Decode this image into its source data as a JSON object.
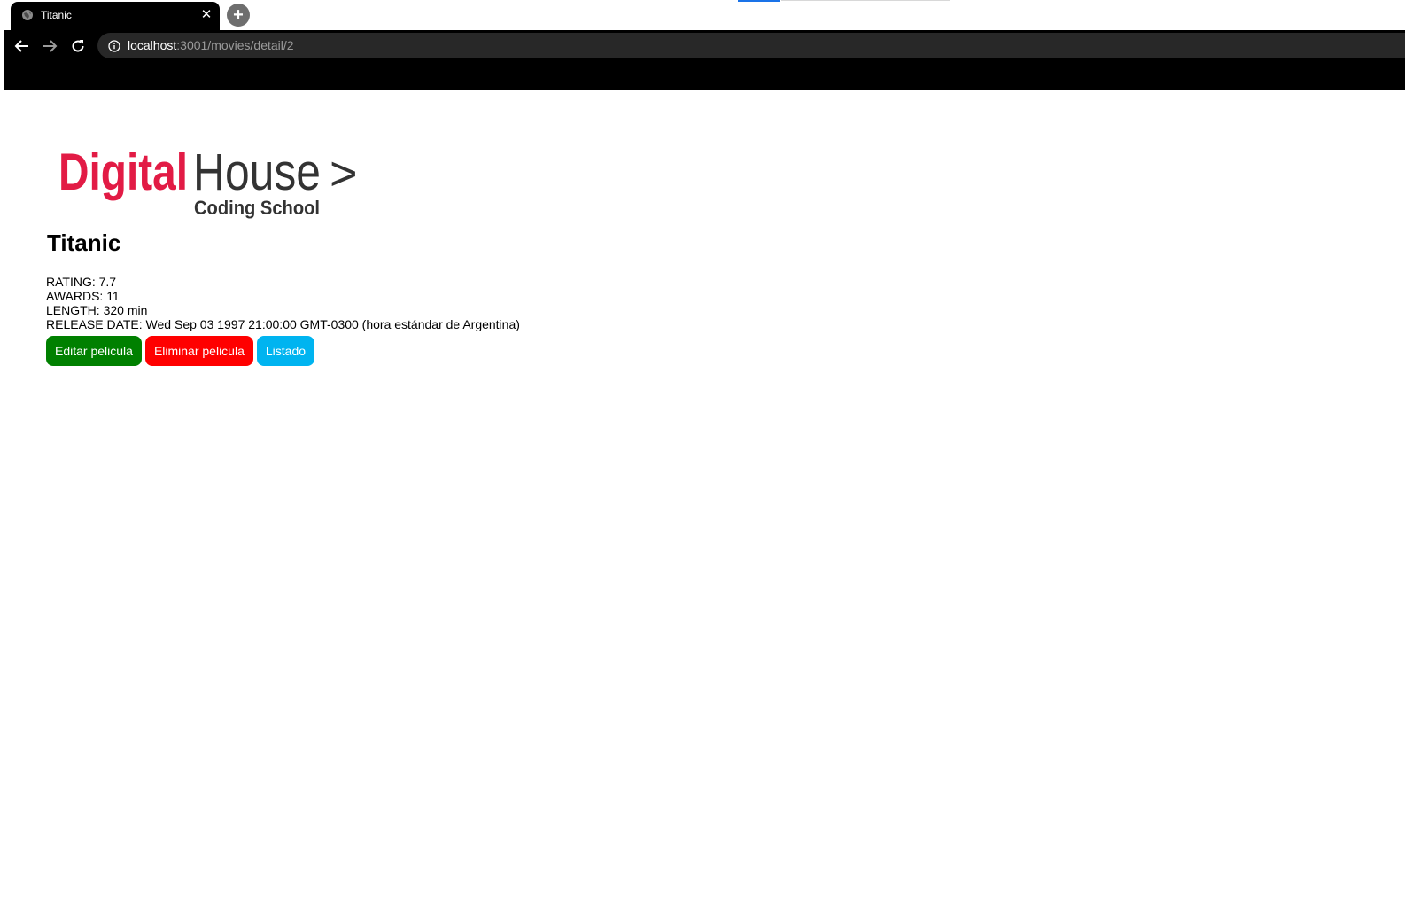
{
  "browser": {
    "tab": {
      "title": "Titanic",
      "close_glyph": "✕",
      "icon": "globe-icon"
    },
    "new_tab_glyph": "+",
    "nav": {
      "back_icon": "arrow-left-icon",
      "forward_icon": "arrow-right-icon",
      "reload_icon": "reload-icon"
    },
    "address": {
      "host": "localhost",
      "path": ":3001/movies/detail/2",
      "info_icon": "info-icon"
    }
  },
  "page": {
    "logo": {
      "brand_primary": "Digital",
      "brand_secondary": "House",
      "arrow": ">",
      "tagline": "Coding School",
      "brand_color": "#e21b45",
      "text_color": "#333333"
    },
    "movie": {
      "title": "Titanic",
      "rating": "RATING: 7.7",
      "awards": "AWARDS: 11",
      "length": "LENGTH: 320 min",
      "release_date": "RELEASE DATE: Wed Sep 03 1997 21:00:00 GMT-0300 (hora estándar de Argentina)"
    },
    "actions": {
      "edit_label": "Editar pelicula",
      "delete_label": "Eliminar pelicula",
      "list_label": "Listado",
      "edit_color": "#008000",
      "delete_color": "#ff0000",
      "list_color": "#00b4f0"
    }
  }
}
